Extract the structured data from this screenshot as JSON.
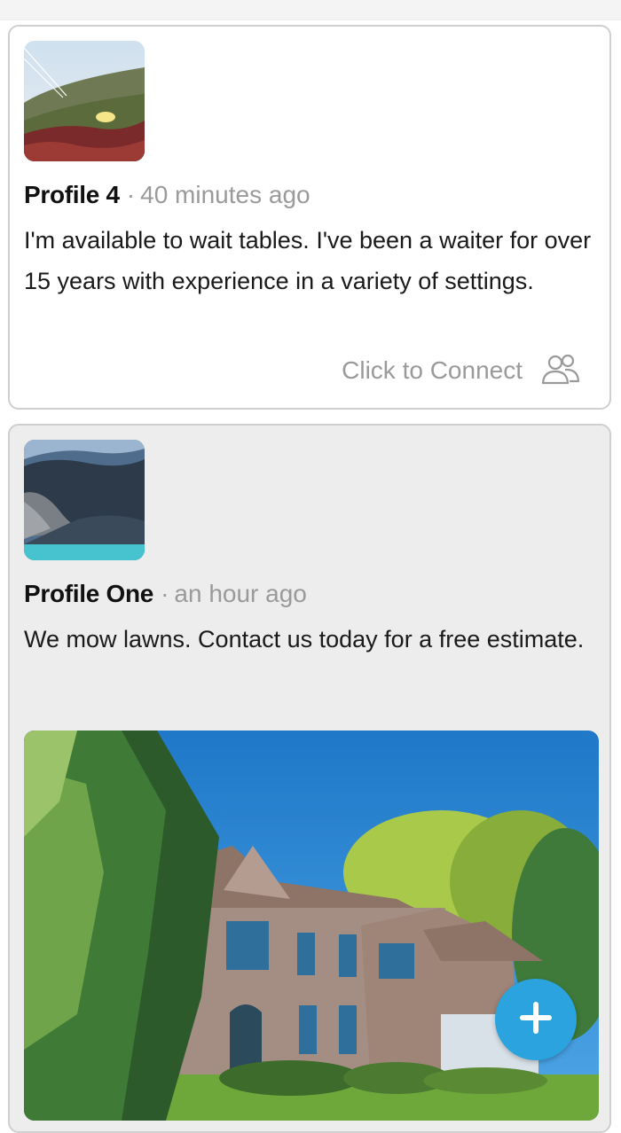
{
  "posts": [
    {
      "author": "Profile 4",
      "separator": "·",
      "time": "40 minutes ago",
      "text": "I'm available to wait tables. I've been a waiter for over 15 years with experience in a variety of settings.",
      "connect_label": "Click to Connect",
      "connect_icon": "people-icon"
    },
    {
      "author": "Profile One",
      "separator": "·",
      "time": "an hour ago",
      "text": "We mow lawns. Contact us today for a free estimate."
    }
  ],
  "fab": {
    "icon": "plus-icon",
    "color": "#2aa3de"
  },
  "colors": {
    "muted_text": "#9a9a9a",
    "card_border": "#cfcfcf",
    "card2_bg": "#ededed"
  }
}
